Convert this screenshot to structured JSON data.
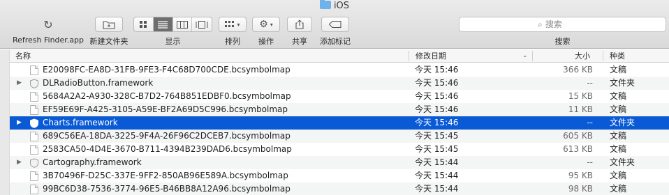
{
  "window": {
    "title": "iOS"
  },
  "toolbar": {
    "refresh_label": "Refresh Finder.app",
    "new_folder_label": "新建文件夹",
    "view_label": "显示",
    "arrange_label": "排列",
    "action_label": "操作",
    "share_label": "共享",
    "tags_label": "添加标记"
  },
  "search": {
    "placeholder": "搜索",
    "label": "搜索"
  },
  "columns": {
    "name": "名称",
    "date": "修改日期",
    "size": "大小",
    "kind": "种类"
  },
  "rows": [
    {
      "name": "E20098FC-EA8D-31FB-9FE3-F4C68D700CDE.bcsymbolmap",
      "date": "今天 15:46",
      "size": "366 KB",
      "kind": "文稿"
    },
    {
      "name": "DLRadioButton.framework",
      "date": "今天 15:46",
      "size": "--",
      "kind": "文件夹"
    },
    {
      "name": "5684A2A2-A930-328C-B7D2-764B851EDBF0.bcsymbolmap",
      "date": "今天 15:46",
      "size": "15 KB",
      "kind": "文稿"
    },
    {
      "name": "EF59E69F-A425-3105-A59E-BF2A69D5C996.bcsymbolmap",
      "date": "今天 15:46",
      "size": "11 KB",
      "kind": "文稿"
    },
    {
      "name": "Charts.framework",
      "date": "今天 15:46",
      "size": "--",
      "kind": "文件夹"
    },
    {
      "name": "689C56EA-18DA-3225-9F4A-26F96C2DCEB7.bcsymbolmap",
      "date": "今天 15:45",
      "size": "605 KB",
      "kind": "文稿"
    },
    {
      "name": "2583CA50-4D4E-3670-B711-4394B239DAD6.bcsymbolmap",
      "date": "今天 15:45",
      "size": "613 KB",
      "kind": "文稿"
    },
    {
      "name": "Cartography.framework",
      "date": "今天 15:44",
      "size": "--",
      "kind": "文件夹"
    },
    {
      "name": "3B70496F-D25C-337E-9FF2-850AB96E589A.bcsymbolmap",
      "date": "今天 15:44",
      "size": "95 KB",
      "kind": "文稿"
    },
    {
      "name": "99BC6D38-7536-3774-96E5-B46BB8A12A96.bcsymbolmap",
      "date": "今天 15:44",
      "size": "98 KB",
      "kind": "文稿"
    }
  ]
}
